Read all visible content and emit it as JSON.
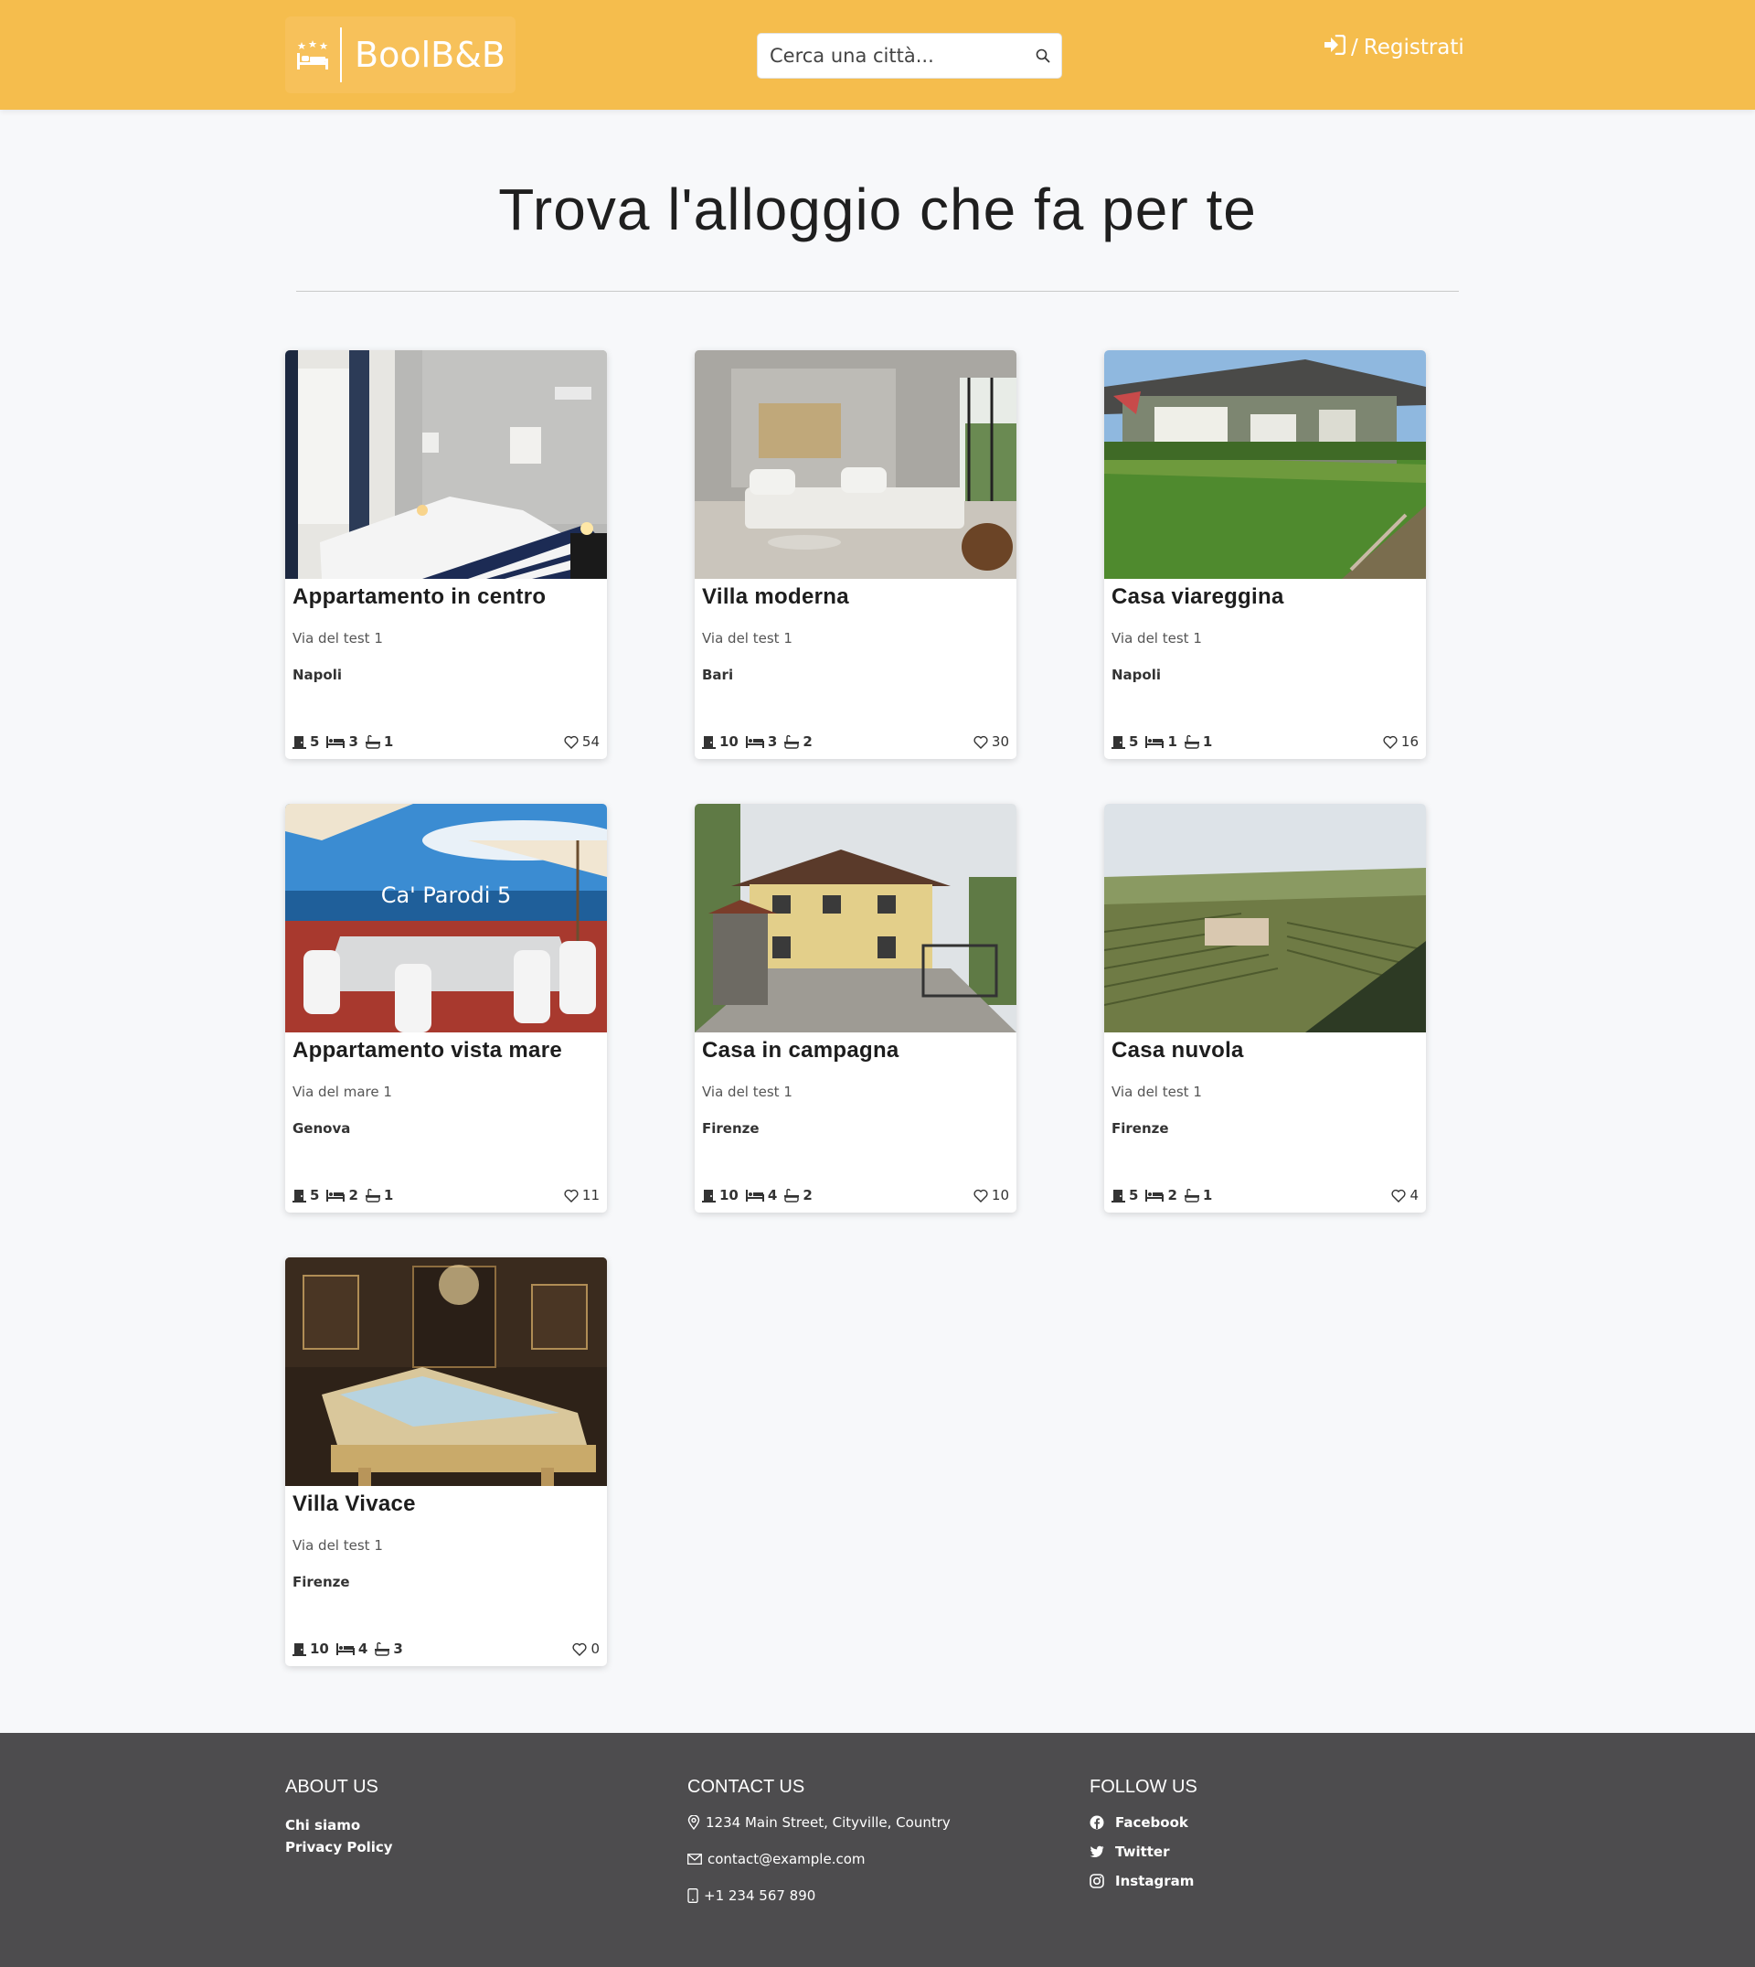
{
  "header": {
    "logo_text": "BoolB&B",
    "search_placeholder": "Cerca una città...",
    "login_separator": "/",
    "register_label": "Registrati"
  },
  "main": {
    "title": "Trova l'alloggio che fa per te"
  },
  "properties": [
    {
      "title": "Appartamento in centro",
      "address": "Via del test 1",
      "city": "Napoli",
      "rooms": "5",
      "beds": "3",
      "bathrooms": "1",
      "likes": "54"
    },
    {
      "title": "Villa moderna",
      "address": "Via del test 1",
      "city": "Bari",
      "rooms": "10",
      "beds": "3",
      "bathrooms": "2",
      "likes": "30"
    },
    {
      "title": "Casa viareggina",
      "address": "Via del test 1",
      "city": "Napoli",
      "rooms": "5",
      "beds": "1",
      "bathrooms": "1",
      "likes": "16"
    },
    {
      "title": "Appartamento vista mare",
      "address": "Via del mare 1",
      "city": "Genova",
      "rooms": "5",
      "beds": "2",
      "bathrooms": "1",
      "likes": "11",
      "image_caption": "Ca' Parodi 5"
    },
    {
      "title": "Casa in campagna",
      "address": "Via del test 1",
      "city": "Firenze",
      "rooms": "10",
      "beds": "4",
      "bathrooms": "2",
      "likes": "10"
    },
    {
      "title": "Casa nuvola",
      "address": "Via del test 1",
      "city": "Firenze",
      "rooms": "5",
      "beds": "2",
      "bathrooms": "1",
      "likes": "4"
    },
    {
      "title": "Villa Vivace",
      "address": "Via del test 1",
      "city": "Firenze",
      "rooms": "10",
      "beds": "4",
      "bathrooms": "3",
      "likes": "0"
    }
  ],
  "footer": {
    "about": {
      "heading": "ABOUT US",
      "links": [
        "Chi siamo",
        "Privacy Policy"
      ]
    },
    "contact": {
      "heading": "CONTACT US",
      "address": "1234 Main Street, Cityville, Country",
      "email": "contact@example.com",
      "phone": "+1 234 567 890"
    },
    "follow": {
      "heading": "FOLLOW US",
      "links": [
        "Facebook",
        "Twitter",
        "Instagram"
      ]
    }
  },
  "colors": {
    "header_bg": "#f5bd4d",
    "footer_bg": "#4d4c4e",
    "page_bg": "#f7f8fa"
  }
}
